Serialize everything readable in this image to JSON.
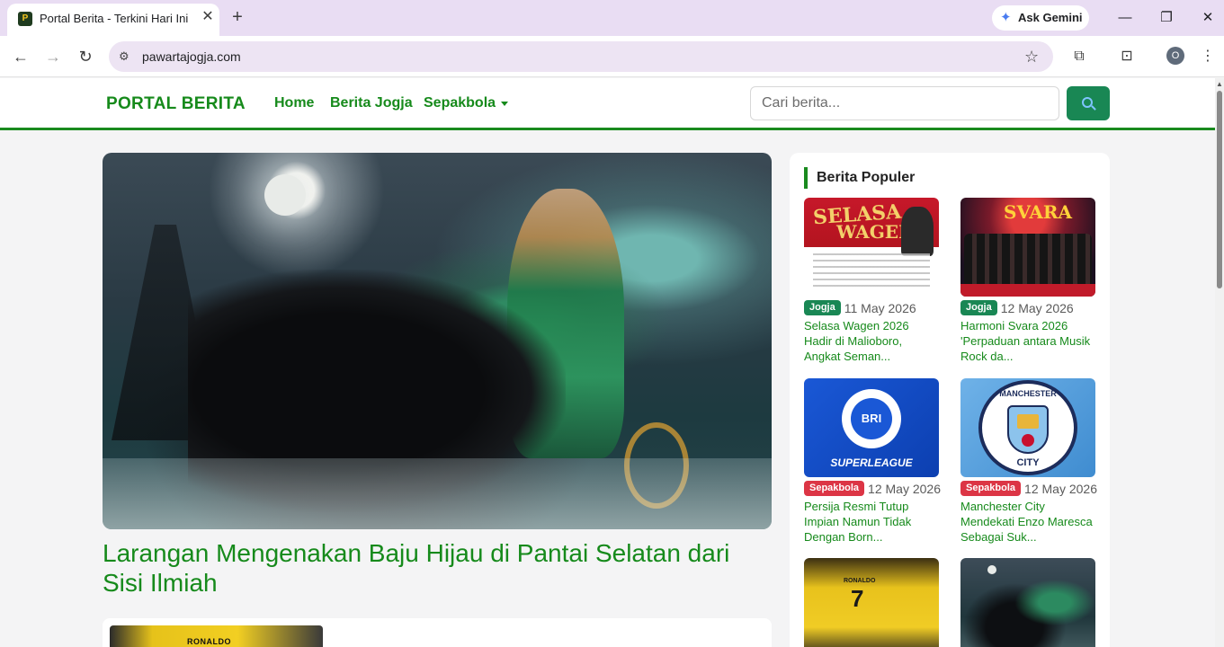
{
  "browser": {
    "tab_title": "Portal Berita - Terkini Hari Ini",
    "tab_close": "✕",
    "new_tab": "+",
    "gemini_label": "Ask Gemini",
    "url": "pawartajogja.com",
    "profile_initial": "O"
  },
  "nav": {
    "brand": "PORTAL BERITA",
    "links": [
      "Home",
      "Berita Jogja",
      "Sepakbola"
    ],
    "search_placeholder": "Cari berita..."
  },
  "headline": {
    "title": "Larangan Mengenakan Baju Hijau di Pantai Selatan dari Sisi Ilmiah"
  },
  "next_article": {
    "thumb_text": "RONALDO"
  },
  "sidebar": {
    "title": "Berita Populer",
    "items": [
      {
        "category": "Jogja",
        "category_color": "#198754",
        "date": "11 May 2026",
        "title": "Selasa Wagen 2026 Hadir di Malioboro, Angkat Seman...",
        "thumb_text": "SELASA WAGEN"
      },
      {
        "category": "Jogja",
        "category_color": "#198754",
        "date": "12 May 2026",
        "title": "Harmoni Svara 2026 'Perpaduan antara Musik Rock da...",
        "thumb_text": "SVARA"
      },
      {
        "category": "Sepakbola",
        "category_color": "#dc3545",
        "date": "12 May 2026",
        "title": "Persija Resmi Tutup Impian Namun Tidak Dengan Born...",
        "thumb_text": "SUPERLEAGUE"
      },
      {
        "category": "Sepakbola",
        "category_color": "#dc3545",
        "date": "12 May 2026",
        "title": "Manchester City Mendekati Enzo Maresca Sebagai Suk...",
        "thumb_text": "MANCHESTER CITY"
      }
    ],
    "more_thumbs": [
      {
        "thumb_text": "RONALDO 7"
      },
      {
        "thumb_text": ""
      }
    ]
  },
  "colors": {
    "brand_green": "#168a1b",
    "button_green": "#198754",
    "badge_red": "#dc3545"
  }
}
